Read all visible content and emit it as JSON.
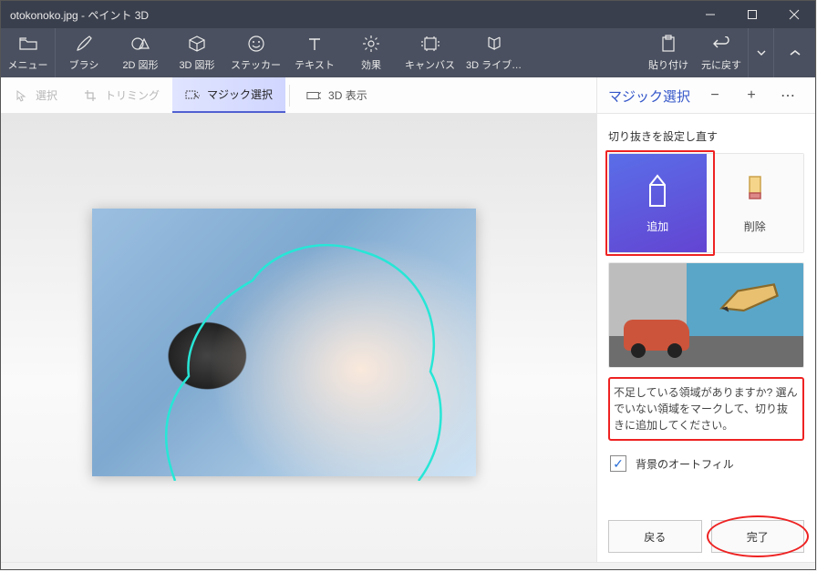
{
  "window": {
    "title": "otokonoko.jpg - ペイント 3D"
  },
  "ribbon": {
    "menu": "メニュー",
    "tools": [
      {
        "id": "brushes",
        "label": "ブラシ"
      },
      {
        "id": "shapes2d",
        "label": "2D 図形"
      },
      {
        "id": "shapes3d",
        "label": "3D 図形"
      },
      {
        "id": "stickers",
        "label": "ステッカー"
      },
      {
        "id": "text",
        "label": "テキスト"
      },
      {
        "id": "effects",
        "label": "効果"
      },
      {
        "id": "canvas",
        "label": "キャンバス"
      },
      {
        "id": "library",
        "label": "3D ライブ…"
      }
    ],
    "right": [
      {
        "id": "paste",
        "label": "貼り付け"
      },
      {
        "id": "undo",
        "label": "元に戻す"
      }
    ]
  },
  "subbar": {
    "select": "選択",
    "trimming": "トリミング",
    "magic_select": "マジック選択",
    "view3d": "3D 表示"
  },
  "panel": {
    "title": "マジック選択",
    "refine_label": "切り抜きを設定し直す",
    "add": "追加",
    "remove": "削除",
    "help": "不足している領域がありますか? 選んでいない領域をマークして、切り抜きに追加してください。",
    "autofill": "背景のオートフィル",
    "autofill_checked": true,
    "back": "戻る",
    "done": "完了"
  }
}
